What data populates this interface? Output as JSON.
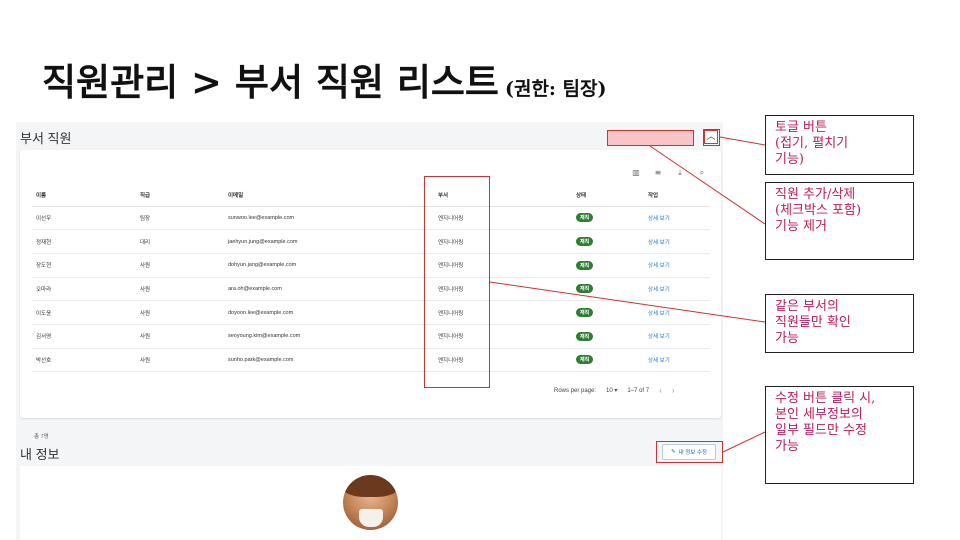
{
  "slide": {
    "title": "직원관리 > 부서 직원 리스트",
    "subtitle": "(권한: 팀장)"
  },
  "section1": {
    "title": "부서 직원",
    "toolbar_icons": [
      "columns-icon",
      "filter-icon",
      "download-icon",
      "search-icon"
    ],
    "columns": [
      "이름",
      "직급",
      "이메일",
      "부서",
      "상태",
      "작업"
    ],
    "rows": [
      [
        "이선우",
        "팀장",
        "sunwoo.lee@example.com",
        "엔지니어링",
        "재직",
        "상세 보기"
      ],
      [
        "정재현",
        "대리",
        "jaehyun.jung@example.com",
        "엔지니어링",
        "재직",
        "상세 보기"
      ],
      [
        "장도현",
        "사원",
        "dohyun.jang@example.com",
        "엔지니어링",
        "재직",
        "상세 보기"
      ],
      [
        "오마라",
        "사원",
        "ara.oh@example.com",
        "엔지니어링",
        "재직",
        "상세 보기"
      ],
      [
        "이도윤",
        "사원",
        "doyoon.lee@example.com",
        "엔지니어링",
        "재직",
        "상세 보기"
      ],
      [
        "김서영",
        "사원",
        "seoyoung.kim@example.com",
        "엔지니어링",
        "재직",
        "상세 보기"
      ],
      [
        "박선호",
        "사원",
        "sunho.park@example.com",
        "엔지니어링",
        "재직",
        "상세 보기"
      ]
    ],
    "pager": {
      "rows_label": "Rows per page:",
      "rows_value": "10",
      "range": "1–7 of 7"
    },
    "total": "총 7명"
  },
  "section2": {
    "title": "내 정보",
    "edit_button": "내 정보 수정"
  },
  "annotations": [
    {
      "lines": [
        "토글 버튼",
        "(접기, 펼치기",
        "기능)"
      ]
    },
    {
      "lines": [
        "직원 추가/삭제",
        "(체크박스 포함)",
        "기능 제거"
      ]
    },
    {
      "lines": [
        "같은 부서의",
        "직원들만 확인",
        "가능"
      ]
    },
    {
      "lines": [
        "수정 버튼 클릭 시,",
        "본인 세부정보의",
        "일부 필드만 수정",
        "가능"
      ]
    }
  ],
  "colors": {
    "highlight": "#d32f2f",
    "annotation_text": "#c2185b",
    "status_badge": "#2e7d32",
    "link": "#1976d2"
  }
}
